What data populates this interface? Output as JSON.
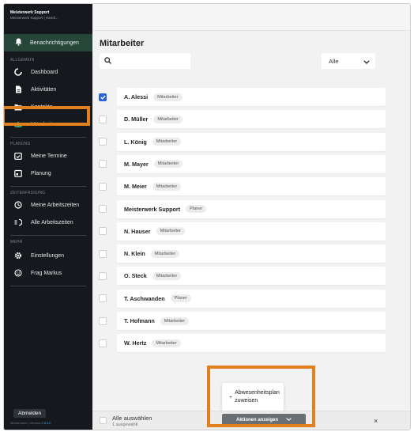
{
  "app": {
    "brand_title": "Meisterwerk Support",
    "brand_subtitle": "Meisterwerk Support | Handi...",
    "version_prefix": "Meisterwerk | Version ",
    "version_number": "2.6.3.0"
  },
  "sidebar": {
    "notifications_label": "Benachrichtigungen",
    "sections": {
      "general": "ALLGEMEIN",
      "planning": "PLANUNG",
      "time": "ZEITERFASSUNG",
      "more": "MEHR"
    },
    "items": [
      {
        "label": "Dashboard",
        "icon": "dashboard-icon"
      },
      {
        "label": "Aktivitäten",
        "icon": "document-icon"
      },
      {
        "label": "Kontakte",
        "icon": "folder-icon"
      },
      {
        "label": "Mitarbeiter",
        "icon": "people-icon"
      },
      {
        "label": "Meine Termine",
        "icon": "calendar-check-icon"
      },
      {
        "label": "Planung",
        "icon": "calendar-icon"
      },
      {
        "label": "Meine Arbeitszeiten",
        "icon": "clock-icon"
      },
      {
        "label": "Alle Arbeitszeiten",
        "icon": "list-clock-icon"
      },
      {
        "label": "Einstellungen",
        "icon": "gear-icon"
      },
      {
        "label": "Frag Markus",
        "icon": "smiley-icon"
      }
    ],
    "logout_label": "Abmelden"
  },
  "main": {
    "title": "Mitarbeiter",
    "search_placeholder": "",
    "filter_value": "Alle",
    "employees": [
      {
        "name": "A. Alessi",
        "role": "Mitarbeiter",
        "checked": true
      },
      {
        "name": "D. Müller",
        "role": "Mitarbeiter",
        "checked": false
      },
      {
        "name": "L. König",
        "role": "Mitarbeiter",
        "checked": false
      },
      {
        "name": "M. Mayer",
        "role": "Mitarbeiter",
        "checked": false
      },
      {
        "name": "M. Meier",
        "role": "Mitarbeiter",
        "checked": false
      },
      {
        "name": "Meisterwerk Support",
        "role": "Planer",
        "checked": false
      },
      {
        "name": "N. Hauser",
        "role": "Mitarbeiter",
        "checked": false
      },
      {
        "name": "N. Klein",
        "role": "Mitarbeiter",
        "checked": false
      },
      {
        "name": "O. Steck",
        "role": "Mitarbeiter",
        "checked": false
      },
      {
        "name": "T. Aschwanden",
        "role": "Planer",
        "checked": false
      },
      {
        "name": "T. Hofmann",
        "role": "Mitarbeiter",
        "checked": false
      },
      {
        "name": "W. Hertz",
        "role": "Mitarbeiter",
        "checked": false
      }
    ]
  },
  "bottom_bar": {
    "select_all_label": "Alle auswählen",
    "selected_count": "1 ausgewählt",
    "actions_label": "Aktionen anzeigen",
    "popup_plus": "+",
    "popup_line1": "Abwesenheitsplan",
    "popup_line2": "zuweisen",
    "close_symbol": "×"
  },
  "colors": {
    "highlight": "#e0801f",
    "sidebar_bg": "#15191d",
    "active_notif_bg": "#27463a",
    "checkbox_checked": "#2a62d9"
  }
}
